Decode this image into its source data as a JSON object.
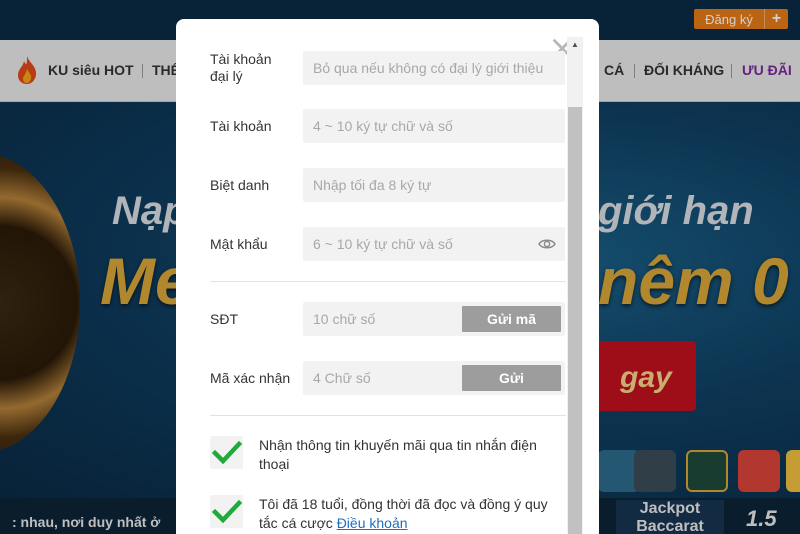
{
  "header": {
    "register_label": "Đăng ký",
    "register_plus": "+"
  },
  "nav": {
    "items": [
      "KU siêu HOT",
      "THỂ",
      "CÁ",
      "ĐỐI KHÁNG",
      "ƯU ĐÃI"
    ]
  },
  "banner": {
    "line1_left": "Nạp",
    "line1_right": "giới hạn",
    "line2_left": "Me",
    "line2_right": "nêm 0",
    "cta": "gay"
  },
  "footer": {
    "ticker": ": nhau, nơi duy nhất ở",
    "jackpot_line1": "Jackpot",
    "jackpot_line2": "Baccarat",
    "jackpot_value": "1.5"
  },
  "form": {
    "agent_label": "Tài khoản đại lý",
    "agent_placeholder": "Bỏ qua nếu không có đại lý giới thiệu",
    "account_label": "Tài khoản",
    "account_placeholder": "4 ~ 10 ký tự chữ và số",
    "nickname_label": "Biệt danh",
    "nickname_placeholder": "Nhập tối đa 8 ký tự",
    "password_label": "Mật khẩu",
    "password_placeholder": "6 ~ 10 ký tự chữ và số",
    "phone_label": "SĐT",
    "phone_placeholder": "10 chữ số",
    "send_code_label": "Gửi mã",
    "verify_label": "Mã xác nhận",
    "verify_placeholder": "4 Chữ số",
    "send_label": "Gửi",
    "promo_text": "Nhận thông tin khuyến mãi qua tin nhắn điện thoại",
    "promo_checked": true,
    "terms_text": "Tôi đã 18 tuổi, đồng thời đã đọc và đồng ý quy tắc cá cược ",
    "terms_link": "Điều khoản",
    "terms_checked": true
  },
  "colors": {
    "accent_orange": "#e47a18",
    "check_green": "#1faa3a",
    "promo_purple": "#7b2a9c",
    "button_gray": "#9d9d9d",
    "link_blue": "#1f6fbf"
  },
  "icons": [
    "flame-icon",
    "close-icon",
    "eye-icon",
    "checkmark-icon",
    "plus-icon"
  ]
}
